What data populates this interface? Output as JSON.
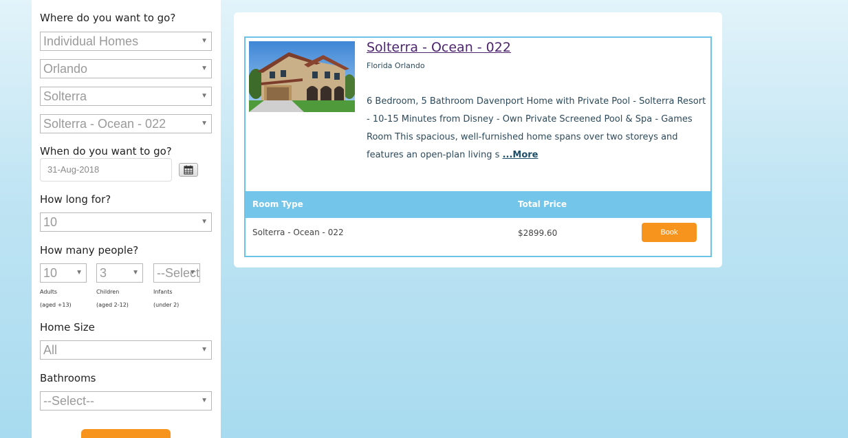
{
  "search": {
    "where_label": "Where do you want to go?",
    "accommodation_type": "Individual Homes",
    "city": "Orlando",
    "resort": "Solterra",
    "property": "Solterra - Ocean - 022",
    "when_label": "When do you want to go?",
    "date": "31-Aug-2018",
    "how_long_label": "How long for?",
    "nights": "10",
    "people_label": "How many people?",
    "adults": "10",
    "children": "3",
    "infants": "--Select--",
    "adults_label": "Adults",
    "adults_age": "(aged +13)",
    "children_label": "Children",
    "children_age": "(aged 2-12)",
    "infants_label": "Infants",
    "infants_age": "(under 2)",
    "home_size_label": "Home Size",
    "home_size": "All",
    "bathrooms_label": "Bathrooms",
    "bathrooms": "--Select--"
  },
  "result": {
    "title": "Solterra - Ocean - 022",
    "location": "Florida Orlando",
    "description": "6 Bedroom, 5 Bathroom Davenport Home with Private Pool - Solterra Resort - 10-15 Minutes from Disney - Own Private Screened Pool & Spa - Games Room This spacious, well-furnished home spans over two storeys and features an open-plan living s ",
    "more_label": "...More",
    "table": {
      "headers": [
        "Room Type",
        "Total Price"
      ],
      "rows": [
        {
          "room_type": "Solterra - Ocean - 022",
          "price": "$2899.60",
          "action": "Book"
        }
      ]
    }
  },
  "colors": {
    "accent_orange": "#f7941d",
    "table_header": "#74c5ea",
    "border_blue": "#6cc3e8",
    "title_purple": "#4d2470"
  },
  "icons": {
    "calendar": "calendar-icon",
    "dropdown": "chevron-down-icon"
  }
}
